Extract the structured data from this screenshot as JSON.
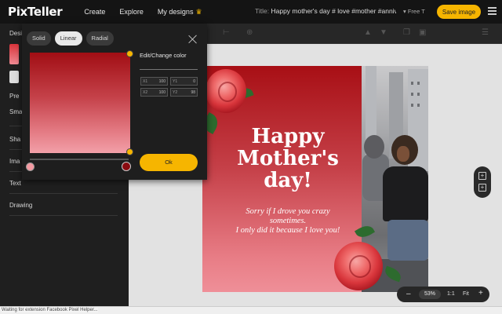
{
  "topbar": {
    "logo": "PixTeller",
    "nav": [
      "Create",
      "Explore",
      "My designs"
    ],
    "title_label": "Title:",
    "title_value": "Happy mother's day # love #mother #anniver",
    "plan": "▾ Free T",
    "save_label": "Save image"
  },
  "sidebar": {
    "items": [
      "Desi",
      "Pre",
      "Sma",
      "Sha",
      "Ima",
      "Text",
      "Drawing"
    ]
  },
  "picker": {
    "modes": [
      "Solid",
      "Linear",
      "Radial"
    ],
    "active_mode": "Linear",
    "edit_label": "Edit/Change color",
    "positions": [
      {
        "k": "X1",
        "v": "100"
      },
      {
        "k": "Y1",
        "v": "0"
      },
      {
        "k": "X2",
        "v": "100"
      },
      {
        "k": "Y2",
        "v": "98"
      }
    ],
    "ok_label": "Ok",
    "stop_colors": [
      "#f49aa2",
      "#8a0b10"
    ]
  },
  "canvas": {
    "headline": "Happy Mother's day!",
    "subtext_lines": [
      "Sorry if I drove you crazy",
      "sometimes.",
      "I only did it because I love you!"
    ]
  },
  "zoom": {
    "minus": "–",
    "value": "53%",
    "ratio": "1:1",
    "fit": "Fit",
    "plus": "+"
  },
  "status": {
    "text": "Waiting for extension Facebook Pixel Helper..."
  },
  "colors": {
    "accent": "#f6b500",
    "gradient_top": "#a10e14",
    "gradient_bottom": "#f2a0a8"
  }
}
